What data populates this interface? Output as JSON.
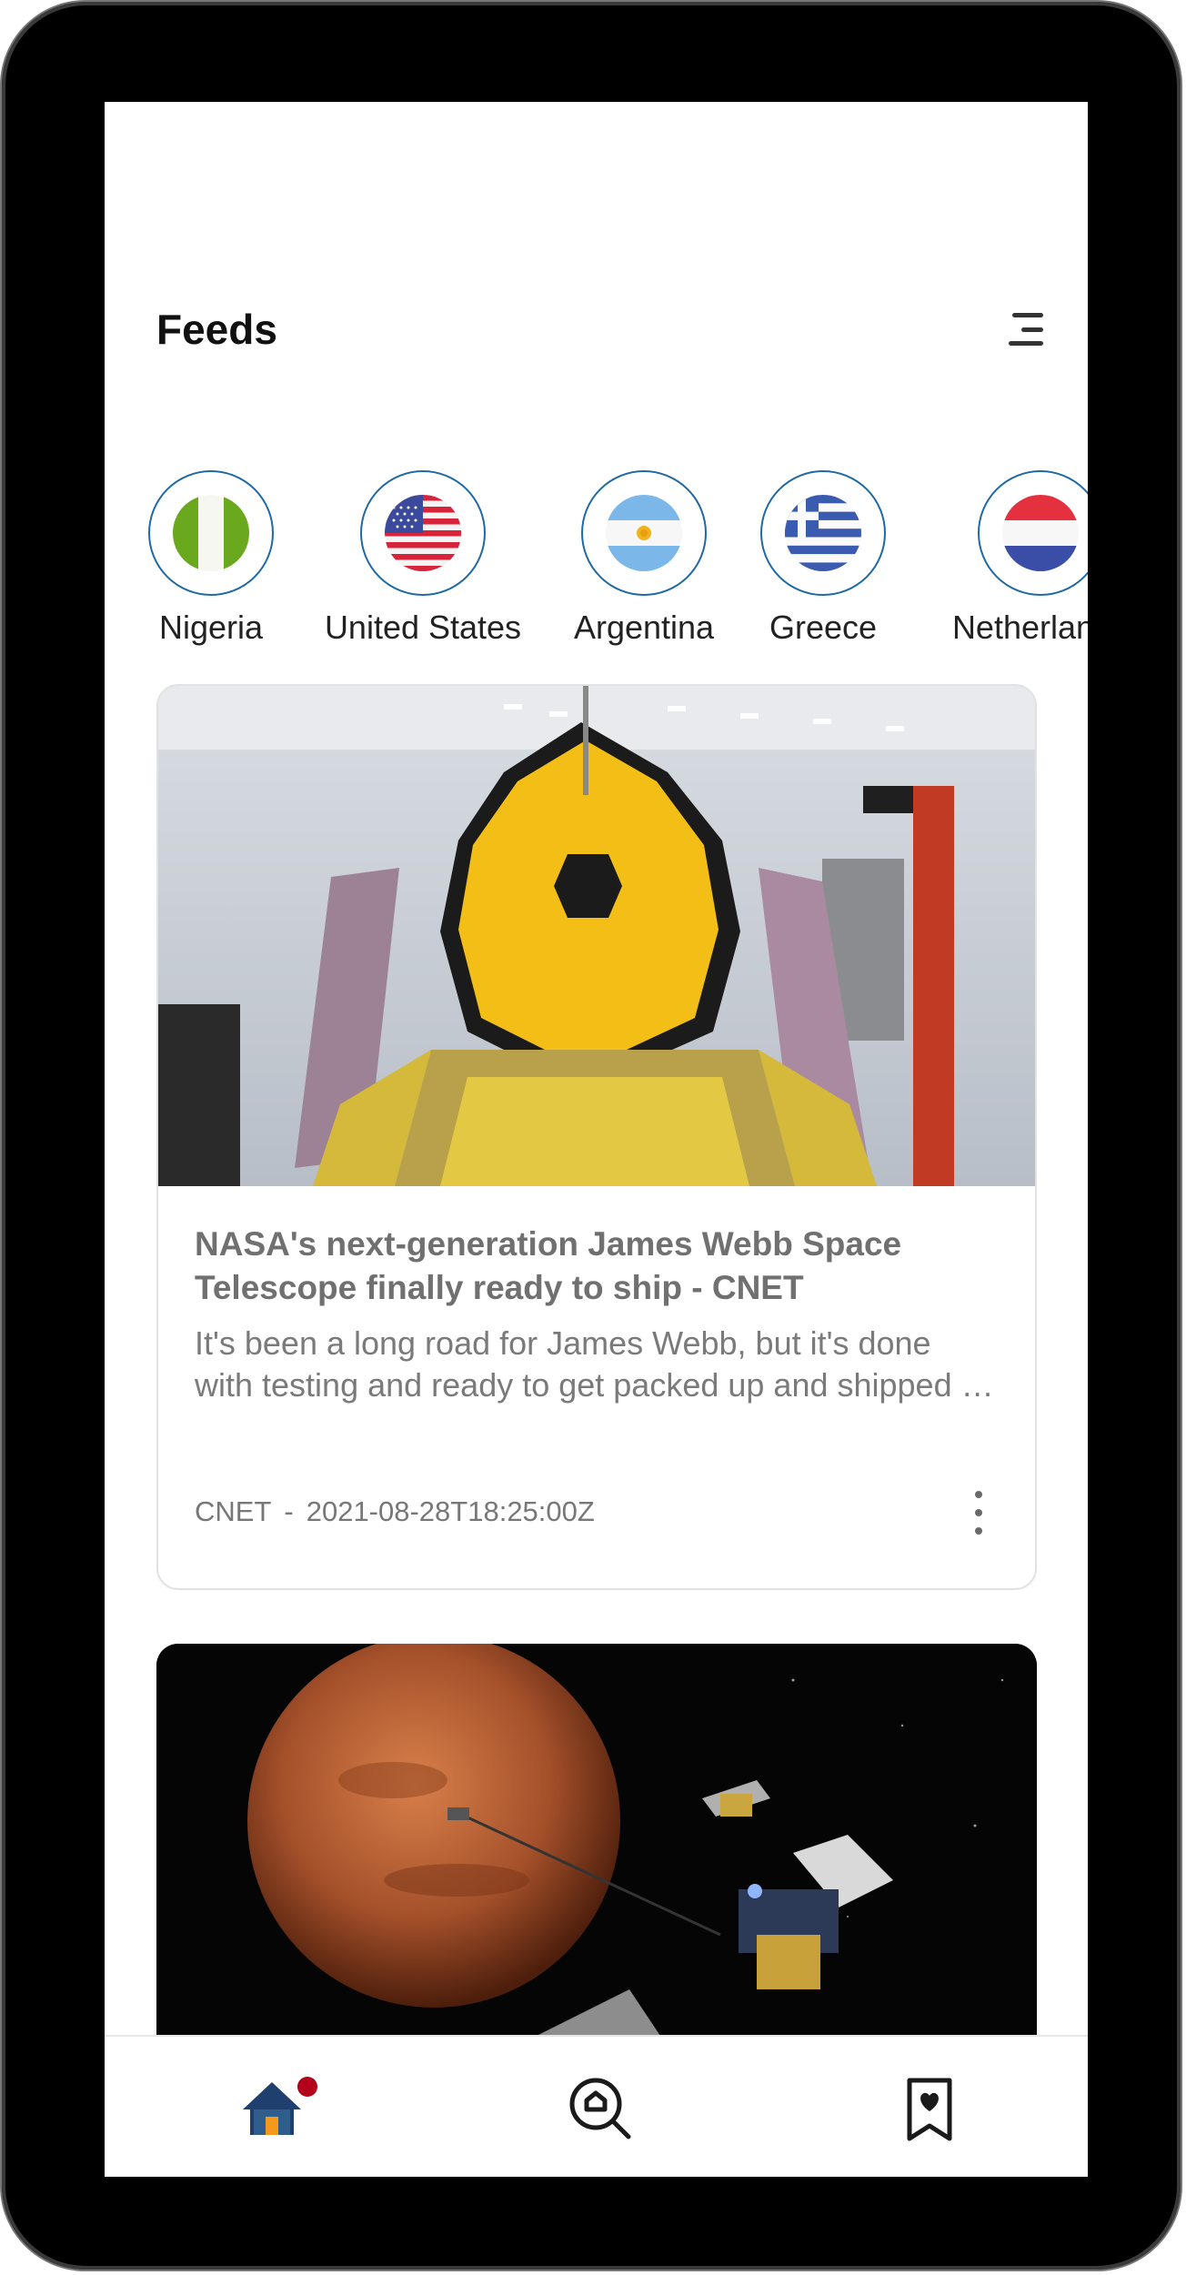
{
  "header": {
    "title": "Feeds",
    "menu_icon": "menu-icon"
  },
  "countries": [
    {
      "name": "Nigeria",
      "flag": "nigeria-flag"
    },
    {
      "name": "United States",
      "flag": "us-flag"
    },
    {
      "name": "Argentina",
      "flag": "argentina-flag"
    },
    {
      "name": "Greece",
      "flag": "greece-flag"
    },
    {
      "name": "Netherlands",
      "flag": "netherlands-flag"
    }
  ],
  "articles": [
    {
      "title": "NASA's next-generation James Webb Space Telescope finally ready to ship - CNET",
      "description": "It's been a long road for James Webb, but it's done with testing and ready to get packed up and shipped to its launch site.",
      "source": "CNET",
      "separator": "-",
      "published_at": "2021-08-28T18:25:00Z",
      "image": "james-webb-telescope-photo"
    },
    {
      "image": "mars-spacecraft-photo"
    }
  ],
  "bottom_nav": {
    "items": [
      "home-icon",
      "search-icon",
      "bookmark-icon"
    ],
    "active": "home-icon",
    "badge_color": "#b3001b",
    "accent": "#1f6aa5"
  }
}
